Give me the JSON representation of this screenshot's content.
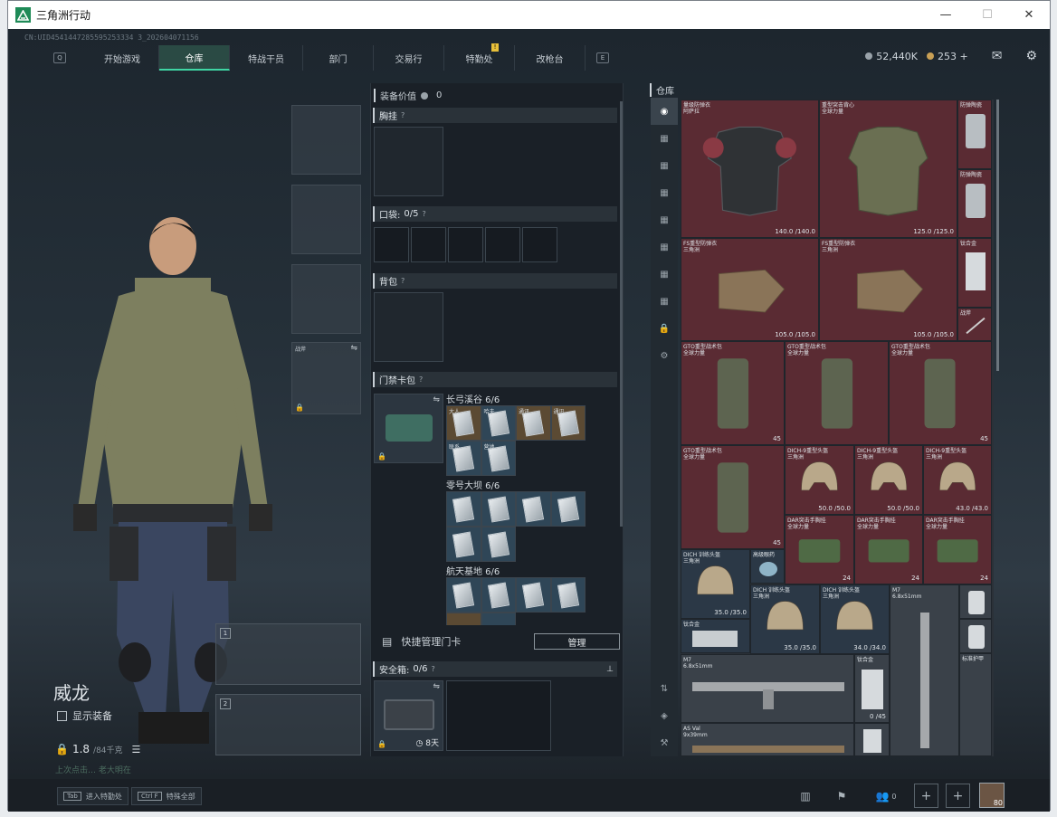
{
  "window": {
    "title": "三角洲行动",
    "minimize": "—",
    "maximize": "☐",
    "close": "✕"
  },
  "uid": "CN:UID4541447285595253334 3_202604071156",
  "nav": {
    "key_left": "Q",
    "key_right": "E",
    "badge": "!",
    "tabs": [
      "开始游戏",
      "仓库",
      "特战干员",
      "部门",
      "交易行",
      "特勤处",
      "改枪台"
    ],
    "active_tab": "仓库"
  },
  "currency": {
    "coins": "52,440K",
    "gold": "253 +"
  },
  "character": {
    "name": "威龙",
    "show_gear_label": "显示装备",
    "weight": "1.8",
    "weight_unit": "/84千克",
    "weapon_slot_1": "1",
    "weapon_slot_2": "2",
    "melee_label": "战斧",
    "footer_hint": "上次点击…  老大明在"
  },
  "equipment": {
    "value_label": "装备价值",
    "value": "0",
    "chest_rig": "胸挂",
    "pocket": "口袋:",
    "pocket_count": "0/5",
    "backpack": "背包",
    "keycard_case": "门禁卡包",
    "groups": [
      {
        "title": "长弓溪谷  6/6"
      },
      {
        "title": "零号大坝  6/6"
      },
      {
        "title": "航天基地  6/6"
      }
    ],
    "card_labels": [
      "大人",
      "哈夫",
      "通讯",
      "通讯",
      "联系",
      "营地"
    ],
    "quick_manage": "快捷管理门卡",
    "manage_button": "管理",
    "safe_box": "安全箱:",
    "safe_count": "0/6",
    "safe_time": "8天"
  },
  "warehouse": {
    "title": "仓库",
    "items": [
      {
        "name": "量级防弹衣\n阿萨拉",
        "dur": "140.0 /140.0"
      },
      {
        "name": "重型突击背心\n全球力量",
        "dur": "125.0 /125.0"
      },
      {
        "name": "防弹陶瓷",
        "dur": ""
      },
      {
        "name": "防弹陶瓷",
        "dur": ""
      },
      {
        "name": "FS重型防弹衣\n三角洲",
        "dur": "105.0 /105.0"
      },
      {
        "name": "FS重型防弹衣\n三角洲",
        "dur": "105.0 /105.0"
      },
      {
        "name": "钛合金",
        "dur": ""
      },
      {
        "name": "战斧",
        "dur": ""
      },
      {
        "name": "GTO重型战术包\n全球力量",
        "dur": "45"
      },
      {
        "name": "GTO重型战术包\n全球力量",
        "dur": ""
      },
      {
        "name": "GTO重型战术包\n全球力量",
        "dur": "45"
      },
      {
        "name": "GTO重型战术包\n全球力量",
        "dur": "45"
      },
      {
        "name": "DICH-9重型头盔\n三角洲",
        "dur": "50.0 /50.0"
      },
      {
        "name": "DICH-9重型头盔\n三角洲",
        "dur": "50.0 /50.0"
      },
      {
        "name": "DICH-9重型头盔\n三角洲",
        "dur": "43.0 /43.0"
      },
      {
        "name": "DAR突击手胸挂\n全球力量",
        "dur": "24"
      },
      {
        "name": "DAR突击手胸挂\n全球力量",
        "dur": "24"
      },
      {
        "name": "DAR突击手胸挂\n全球力量",
        "dur": "24"
      },
      {
        "name": "DICH 训练头盔\n三角洲",
        "dur": "35.0 /35.0"
      },
      {
        "name": "高级眼药",
        "dur": ""
      },
      {
        "name": "DICH 训练头盔\n三角洲",
        "dur": "35.0 /35.0"
      },
      {
        "name": "DICH 训练头盔\n三角洲",
        "dur": "34.0 /34.0"
      },
      {
        "name": "M7\n6.8x51mm",
        "dur": ""
      },
      {
        "name": "钛合金",
        "dur": ""
      },
      {
        "name": "M7\n6.8x51mm",
        "dur": ""
      },
      {
        "name": "钛合金",
        "dur": "0 /45"
      },
      {
        "name": "AS Val\n9x39mm",
        "dur": ""
      },
      {
        "name": "标准护甲",
        "dur": ""
      }
    ]
  },
  "bottom": {
    "hint_1_key": "Tab",
    "hint_1": "进入特勤处",
    "hint_2_key": "Ctrl F",
    "hint_2": "特殊全部",
    "squad_count": "0",
    "level": "80"
  }
}
